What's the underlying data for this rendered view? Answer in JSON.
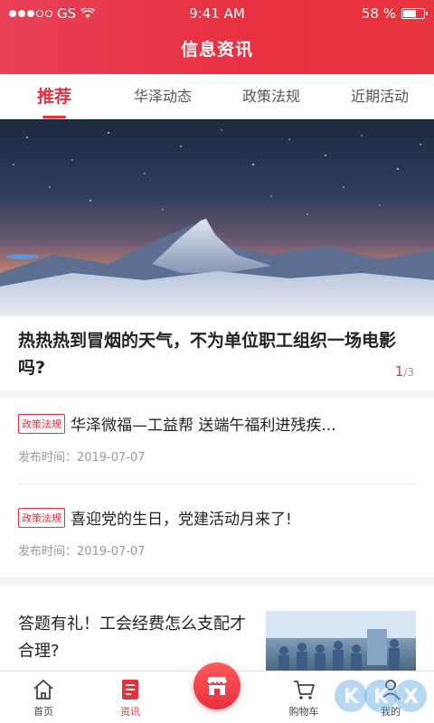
{
  "status": {
    "carrier": "GS",
    "time": "9:41 AM",
    "battery": "58 %",
    "icons": [
      "signal-dots-icon",
      "wifi-icon",
      "battery-icon"
    ]
  },
  "header": {
    "title": "信息资讯"
  },
  "tabs": [
    {
      "label": "推荐",
      "active": true
    },
    {
      "label": "华泽动态",
      "active": false
    },
    {
      "label": "政策法规",
      "active": false
    },
    {
      "label": "近期活动",
      "active": false
    }
  ],
  "banner": {
    "headline": "热热热到冒烟的天气，不为单位职工组织一场电影吗?",
    "pager_current": "1",
    "pager_total": "/3"
  },
  "news": [
    {
      "tag": "政策法规",
      "title": "华泽微福—工益帮 送端午福利进残疾...",
      "date": "发布时间：2019-07-07"
    },
    {
      "tag": "政策法规",
      "title": "喜迎党的生日，党建活动月来了!",
      "date": "发布时间：2019-07-07"
    }
  ],
  "quiz": {
    "title": "答题有礼！工会经费怎么支配才合理?"
  },
  "bottom_nav": [
    {
      "label": "首页",
      "icon": "home-icon",
      "active": false
    },
    {
      "label": "资讯",
      "icon": "news-icon",
      "active": true
    },
    {
      "label": "",
      "icon": "shop-icon",
      "active": false
    },
    {
      "label": "购物车",
      "icon": "cart-icon",
      "active": false
    },
    {
      "label": "我的",
      "icon": "profile-icon",
      "active": false
    }
  ],
  "colors": {
    "accent": "#e8303f",
    "header_start": "#e94057",
    "text": "#222222",
    "muted": "#999999"
  },
  "watermark": "KKX"
}
